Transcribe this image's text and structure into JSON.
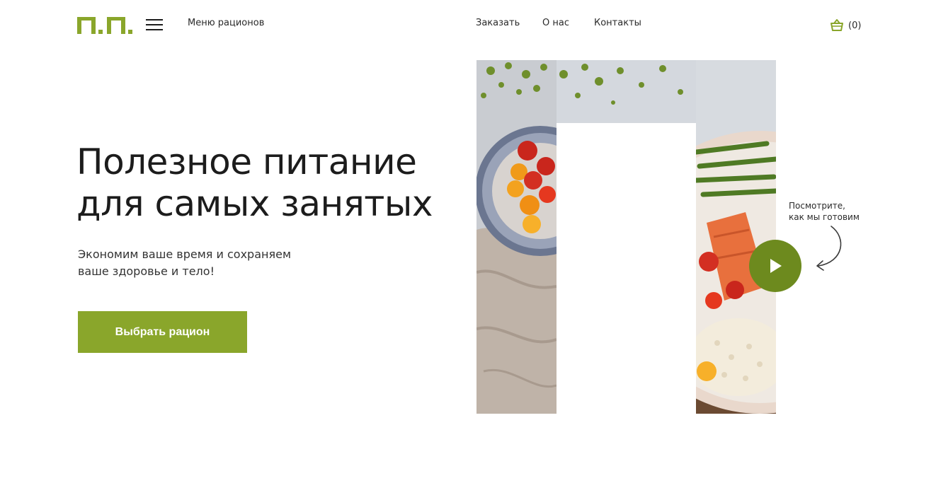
{
  "header": {
    "logo_text": "П.П.",
    "menu_label": "Меню рационов",
    "nav": [
      "Заказать",
      "О нас",
      "Контакты"
    ],
    "cart_count": "(0)"
  },
  "hero": {
    "title_line1": "Полезное питание",
    "title_line2": "для самых занятых",
    "subtitle_line1": "Экономим ваше время и сохраняем",
    "subtitle_line2": "ваше здоровье и тело!",
    "cta_label": "Выбрать рацион"
  },
  "video": {
    "note_line1": "Посмотрите,",
    "note_line2": "как мы готовим"
  },
  "colors": {
    "brand": "#8aa62b",
    "play": "#6d8a1e",
    "text": "#1c1c1c"
  },
  "icons": [
    "burger-menu-icon",
    "basket-icon",
    "play-icon",
    "curved-arrow-icon"
  ]
}
